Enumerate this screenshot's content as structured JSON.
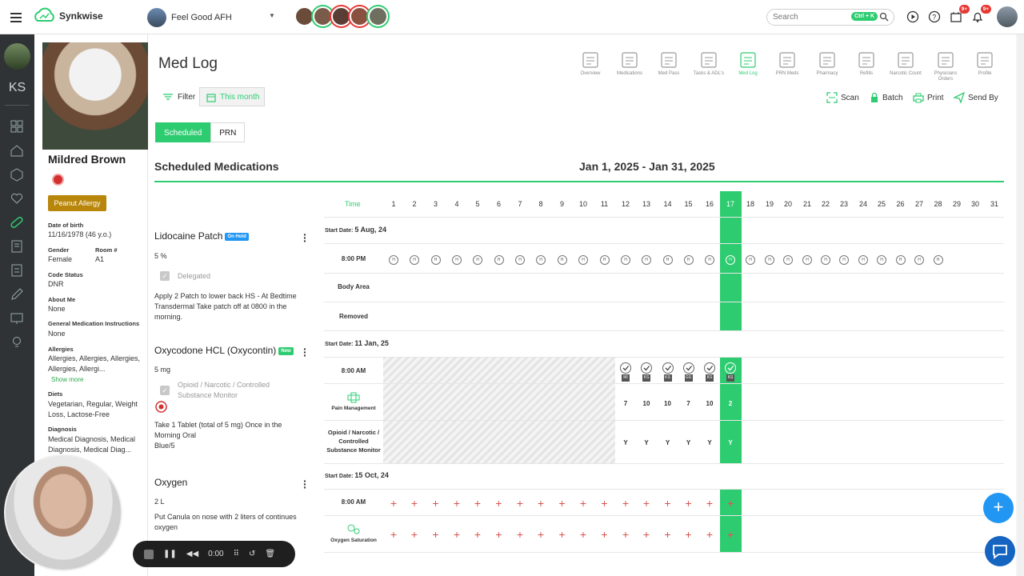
{
  "app": {
    "name": "Synkwise",
    "facility": "Feel Good AFH"
  },
  "search": {
    "placeholder": "Search",
    "shortcut": "Ctrl + K"
  },
  "badges": {
    "tasks": "9+",
    "notifications": "9+"
  },
  "rail": {
    "initials": "KS"
  },
  "patient": {
    "name": "Mildred Brown",
    "allergy_button": "Peanut Allergy",
    "fields": {
      "dob_label": "Date of birth",
      "dob": "11/16/1978 (46 y.o.)",
      "gender_label": "Gender",
      "gender": "Female",
      "room_label": "Room #",
      "room": "A1",
      "code_label": "Code Status",
      "code": "DNR",
      "about_label": "About Me",
      "about": "None",
      "gmi_label": "General Medication Instructions",
      "gmi": "None",
      "allergies_label": "Allergies",
      "allergies": "Allergies, Allergies, Allergies, Allergies, Allergi...",
      "show_more": "Show more",
      "diets_label": "Diets",
      "diets": "Vegetarian, Regular, Weight Loss, Lactose-Free",
      "diagnosis_label": "Diagnosis",
      "diagnosis": "Medical Diagnosis, Medical Diagnosis, Medical Diag..."
    }
  },
  "page": {
    "title": "Med Log",
    "nav": [
      {
        "label": "Overview",
        "icon": "overview-icon"
      },
      {
        "label": "Medications",
        "icon": "medications-icon"
      },
      {
        "label": "Med Pass",
        "icon": "med-pass-icon"
      },
      {
        "label": "Tasks & ADL's",
        "icon": "tasks-icon"
      },
      {
        "label": "Med Log",
        "icon": "med-log-icon",
        "active": true
      },
      {
        "label": "PRN Meds",
        "icon": "prn-icon"
      },
      {
        "label": "Pharmacy",
        "icon": "pharmacy-icon"
      },
      {
        "label": "Refills",
        "icon": "refills-icon"
      },
      {
        "label": "Narcotic Count",
        "icon": "narcotic-icon"
      },
      {
        "label": "Physicians Orders",
        "icon": "physician-icon"
      },
      {
        "label": "Profile",
        "icon": "profile-icon"
      }
    ],
    "filter": "Filter",
    "this_month": "This month",
    "actions": {
      "scan": "Scan",
      "batch": "Batch",
      "print": "Print",
      "send_by": "Send By"
    },
    "tabs": {
      "scheduled": "Scheduled",
      "prn": "PRN"
    },
    "section_title": "Scheduled Medications",
    "date_range": "Jan 1, 2025 - Jan 31, 2025",
    "time_header": "Time",
    "days": [
      "1",
      "2",
      "3",
      "4",
      "5",
      "6",
      "7",
      "8",
      "9",
      "10",
      "11",
      "12",
      "13",
      "14",
      "15",
      "16",
      "17",
      "18",
      "19",
      "20",
      "21",
      "22",
      "23",
      "24",
      "25",
      "26",
      "27",
      "28",
      "29",
      "30",
      "31"
    ],
    "today": "17",
    "hold_mark": "H",
    "start_prefix": "Start Date:"
  },
  "meds": {
    "lidocaine": {
      "name": "Lidocaine Patch",
      "tag": "On Hold",
      "dose": "5 %",
      "checkbox_label": "Delegated",
      "instructions": "Apply 2 Patch to lower back HS - At Bedtime Transdermal Take patch off at 0800 in the morning.",
      "start_date": "5 Aug, 24",
      "rows": [
        "8:00 PM",
        "Body Area",
        "Removed"
      ]
    },
    "oxycodone": {
      "name": "Oxycodone HCL (Oxycontin)",
      "tag": "New",
      "dose": "5 mg",
      "checkbox_label": "Opioid / Narcotic / Controlled Substance Monitor",
      "instructions": "Take 1 Tablet (total of 5 mg) Once in the Morning Oral",
      "instructions2": "Blue/5",
      "start_date": "11 Jan, 25",
      "rows": [
        "8:00 AM",
        "Pain Management",
        "Opioid / Narcotic / Controlled Substance Monitor"
      ],
      "initials": [
        "MI",
        "KS",
        "KS",
        "GS",
        "KS",
        "KS"
      ],
      "pain": [
        "7",
        "10",
        "10",
        "7",
        "10",
        "2"
      ],
      "monitor": [
        "Y",
        "Y",
        "Y",
        "Y",
        "Y",
        "Y"
      ]
    },
    "oxygen": {
      "name": "Oxygen",
      "dose": "2 L",
      "instructions": "Put Canula on nose with 2 liters of continues oxygen",
      "start_date": "15 Oct, 24",
      "rows": [
        "8:00 AM",
        "Oxygen Saturation"
      ],
      "mark": "+"
    }
  },
  "recorder": {
    "time": "0:00"
  },
  "colors": {
    "accent": "#2ecc71",
    "hold_tag": "#2196f3",
    "new_tag": "#2ecc71",
    "allergy": "#b8860b",
    "plus": "#d9534f"
  }
}
